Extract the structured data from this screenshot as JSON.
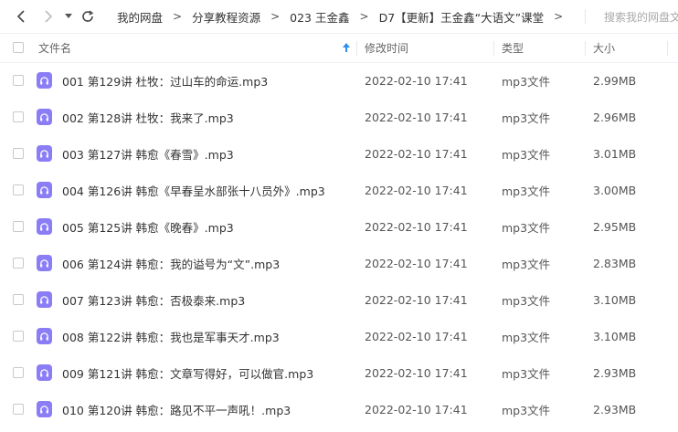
{
  "toolbar": {
    "back": "back-icon",
    "forward": "forward-icon",
    "history": "dropdown-icon",
    "refresh": "refresh-icon"
  },
  "breadcrumb": [
    "我的网盘",
    "分享教程资源",
    "023 王金鑫",
    "D7【更新】王金鑫“大语文”课堂"
  ],
  "breadcrumb_separator": ">",
  "search": {
    "placeholder": "搜索我的网盘文件"
  },
  "columns": {
    "name": "文件名",
    "modified": "修改时间",
    "type": "类型",
    "size": "大小"
  },
  "sort": {
    "column": "name",
    "direction": "ascending"
  },
  "accent_color": "#8a7df5",
  "files": [
    {
      "name": "001 第129讲 杜牧：过山车的命运.mp3",
      "modified": "2022-02-10 17:41",
      "type": "mp3文件",
      "size": "2.99MB"
    },
    {
      "name": "002 第128讲 杜牧：我来了.mp3",
      "modified": "2022-02-10 17:41",
      "type": "mp3文件",
      "size": "2.96MB"
    },
    {
      "name": "003 第127讲 韩愈《春雪》.mp3",
      "modified": "2022-02-10 17:41",
      "type": "mp3文件",
      "size": "3.01MB"
    },
    {
      "name": "004 第126讲 韩愈《早春呈水部张十八员外》.mp3",
      "modified": "2022-02-10 17:41",
      "type": "mp3文件",
      "size": "3.00MB"
    },
    {
      "name": "005 第125讲 韩愈《晚春》.mp3",
      "modified": "2022-02-10 17:41",
      "type": "mp3文件",
      "size": "2.95MB"
    },
    {
      "name": "006 第124讲 韩愈：我的谥号为“文”.mp3",
      "modified": "2022-02-10 17:41",
      "type": "mp3文件",
      "size": "2.83MB"
    },
    {
      "name": "007 第123讲 韩愈：否极泰来.mp3",
      "modified": "2022-02-10 17:41",
      "type": "mp3文件",
      "size": "3.10MB"
    },
    {
      "name": "008 第122讲 韩愈：我也是军事天才.mp3",
      "modified": "2022-02-10 17:41",
      "type": "mp3文件",
      "size": "3.10MB"
    },
    {
      "name": "009 第121讲 韩愈：文章写得好，可以做官.mp3",
      "modified": "2022-02-10 17:41",
      "type": "mp3文件",
      "size": "2.93MB"
    },
    {
      "name": "010 第120讲 韩愈：路见不平一声吼！.mp3",
      "modified": "2022-02-10 17:41",
      "type": "mp3文件",
      "size": "2.93MB"
    }
  ]
}
